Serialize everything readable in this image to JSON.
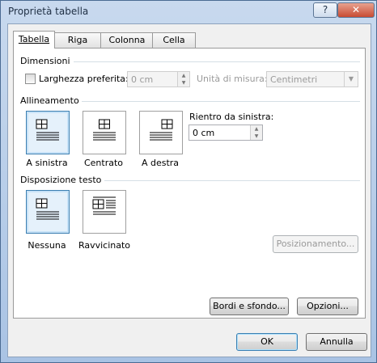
{
  "window": {
    "title": "Proprietà tabella",
    "help_label": "?",
    "close_label": "✕"
  },
  "tabs": [
    {
      "label": "Tabella",
      "active": true
    },
    {
      "label": "Riga",
      "active": false
    },
    {
      "label": "Colonna",
      "active": false
    },
    {
      "label": "Cella",
      "active": false
    }
  ],
  "dimensioni": {
    "group_label": "Dimensioni",
    "preferred_width_label": "Larghezza preferita:",
    "preferred_width_checked": false,
    "preferred_width_value": "0 cm",
    "unit_label": "Unità di misura:",
    "unit_value": "Centimetri"
  },
  "allineamento": {
    "group_label": "Allineamento",
    "options": [
      "A sinistra",
      "Centrato",
      "A destra"
    ],
    "selected": "A sinistra",
    "indent_label": "Rientro da sinistra:",
    "indent_value": "0 cm"
  },
  "disposizione": {
    "group_label": "Disposizione testo",
    "options": [
      "Nessuna",
      "Ravvicinato"
    ],
    "selected": "Nessuna",
    "positioning_button": "Posizionamento..."
  },
  "buttons": {
    "borders": "Bordi e sfondo...",
    "options": "Opzioni...",
    "ok": "OK",
    "cancel": "Annulla"
  },
  "colors": {
    "selection_border": "#3c7fb1",
    "selection_fill": "#e5f1fb",
    "disabled_text": "#9a9a9a"
  }
}
